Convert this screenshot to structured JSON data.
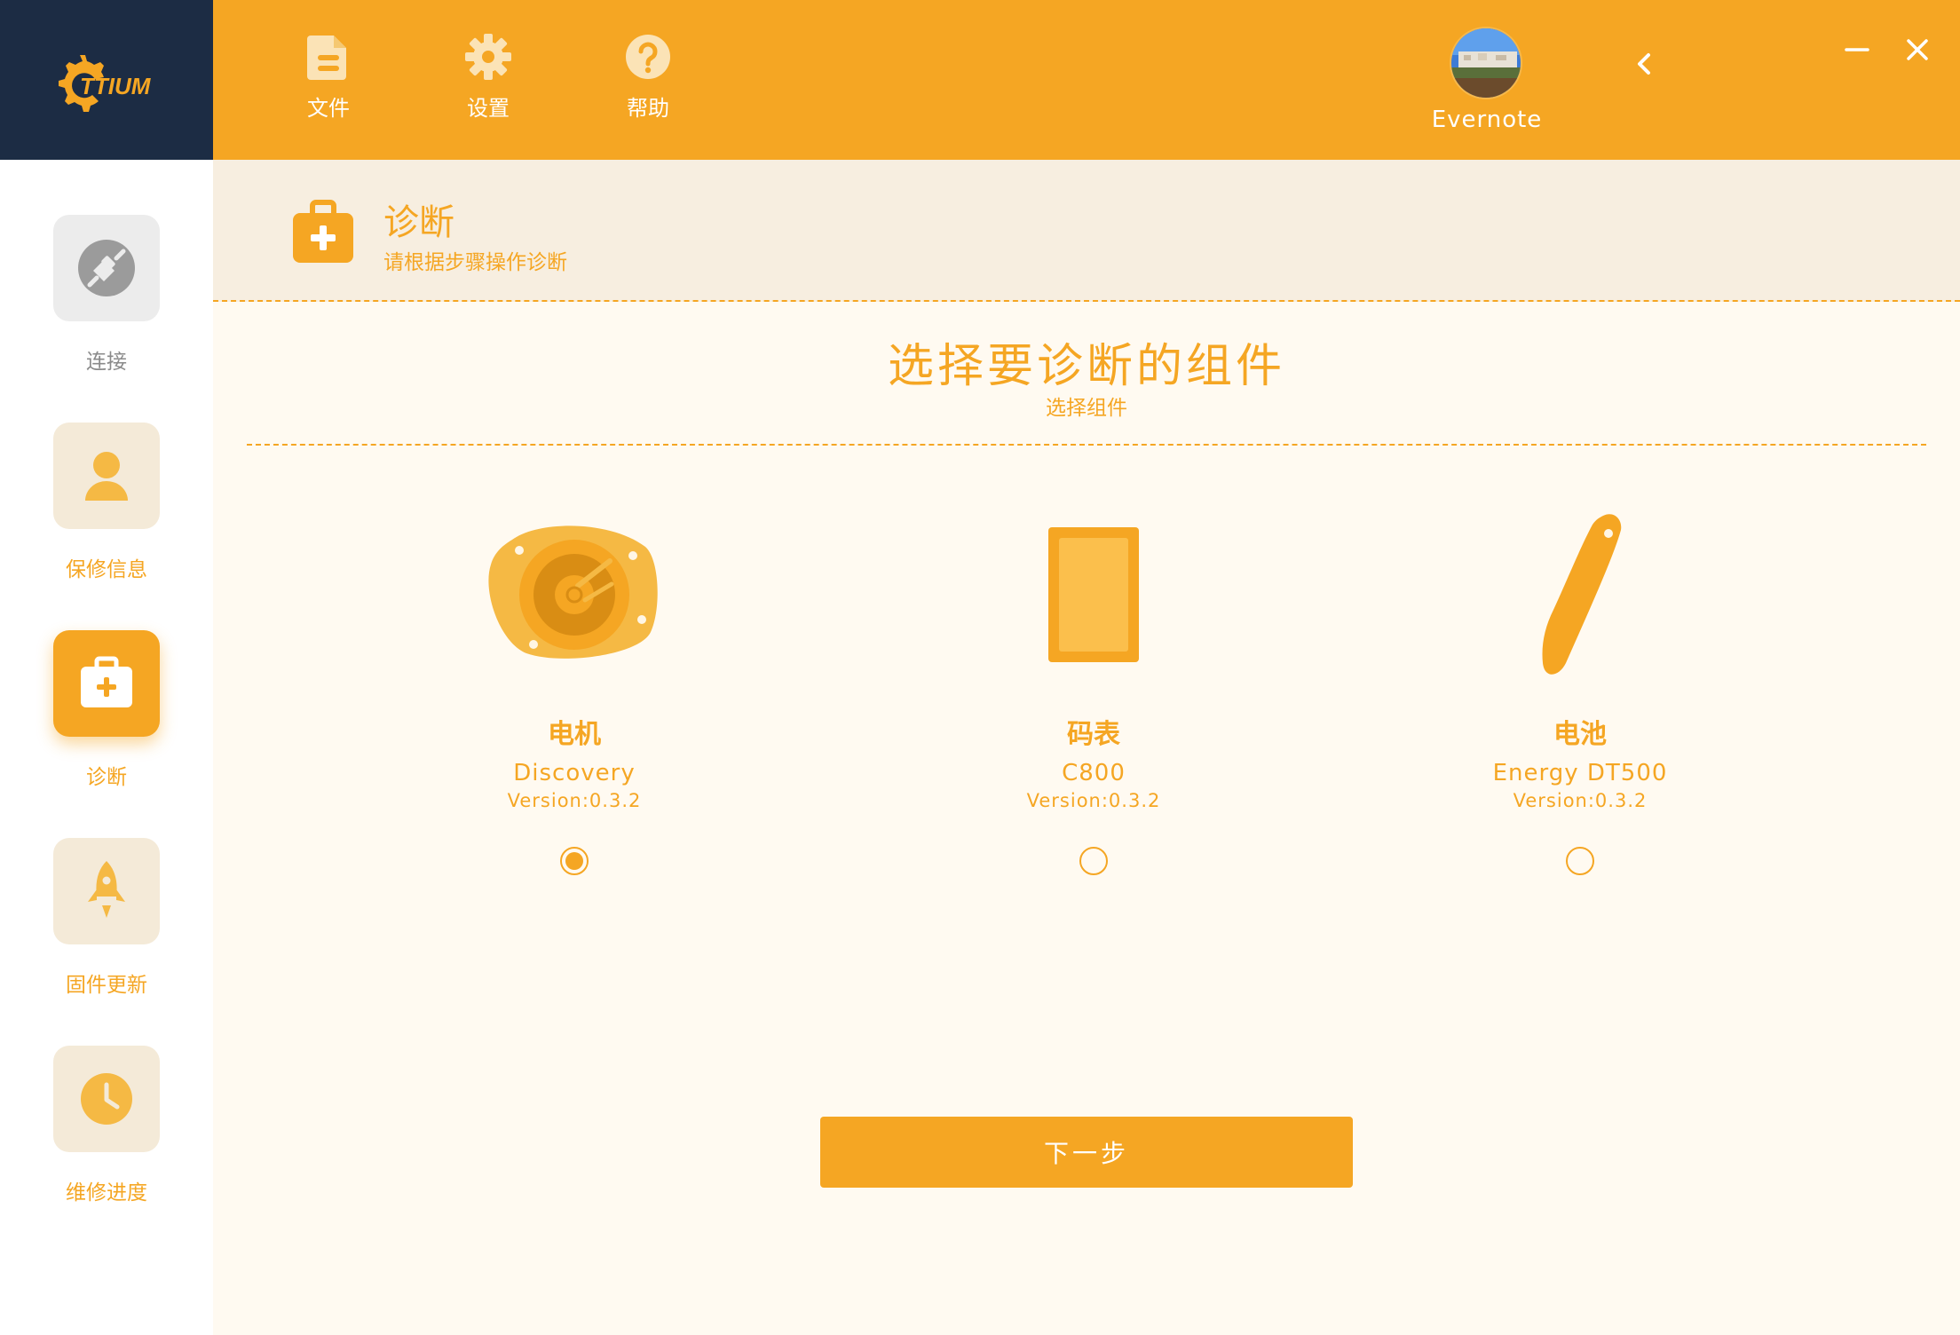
{
  "brand": {
    "logo_text": "TTIUM"
  },
  "toolbar": {
    "items": [
      {
        "label": "文件",
        "icon": "file-icon"
      },
      {
        "label": "设置",
        "icon": "gear-icon"
      },
      {
        "label": "帮助",
        "icon": "help-icon"
      }
    ]
  },
  "user": {
    "name": "Evernote"
  },
  "sidebar": {
    "items": [
      {
        "label": "连接",
        "icon": "plug-icon",
        "state": "disabled"
      },
      {
        "label": "保修信息",
        "icon": "person-icon",
        "state": "normal"
      },
      {
        "label": "诊断",
        "icon": "medkit-icon",
        "state": "active"
      },
      {
        "label": "固件更新",
        "icon": "rocket-icon",
        "state": "normal"
      },
      {
        "label": "维修进度",
        "icon": "clock-icon",
        "state": "normal"
      }
    ]
  },
  "section": {
    "title": "诊断",
    "subtitle": "请根据步骤操作诊断"
  },
  "step": {
    "title": "选择要诊断的组件",
    "subtitle": "选择组件"
  },
  "components": [
    {
      "name": "电机",
      "model": "Discovery",
      "version": "Version:0.3.2",
      "selected": true,
      "icon": "motor-icon"
    },
    {
      "name": "码表",
      "model": "C800",
      "version": "Version:0.3.2",
      "selected": false,
      "icon": "display-icon"
    },
    {
      "name": "电池",
      "model": "Energy DT500",
      "version": "Version:0.3.2",
      "selected": false,
      "icon": "battery-icon"
    }
  ],
  "actions": {
    "next_label": "下一步"
  },
  "colors": {
    "accent": "#f5a623",
    "logo_bg": "#1c2c44",
    "content_bg": "#fffaf1",
    "header_bg": "#f7eee0"
  }
}
